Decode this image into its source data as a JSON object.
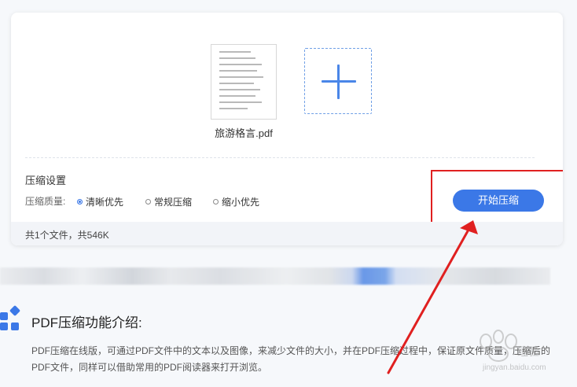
{
  "upload": {
    "file_name": "旅游格言.pdf",
    "add_icon": "plus-icon"
  },
  "settings": {
    "title": "压缩设置",
    "quality_label": "压缩质量:",
    "options": [
      {
        "label": "清晰优先",
        "selected": true
      },
      {
        "label": "常规压缩",
        "selected": false
      },
      {
        "label": "缩小优先",
        "selected": false
      }
    ],
    "start_label": "开始压缩"
  },
  "footer": {
    "summary": "共1个文件，共546K"
  },
  "intro": {
    "icon": "app-grid-icon",
    "heading": "PDF压缩功能介绍:",
    "body": "PDF压缩在线版，可通过PDF文件中的文本以及图像，来减少文件的大小，并在PDF压缩过程中，保证原文件质量，压缩后的PDF文件，同样可以借助常用的PDF阅读器来打开浏览。"
  },
  "watermark": {
    "text": "Baidu经验",
    "url_text": "jingyan.baidu.com"
  },
  "colors": {
    "accent": "#3b78e7",
    "annotation_red": "#e02020"
  }
}
